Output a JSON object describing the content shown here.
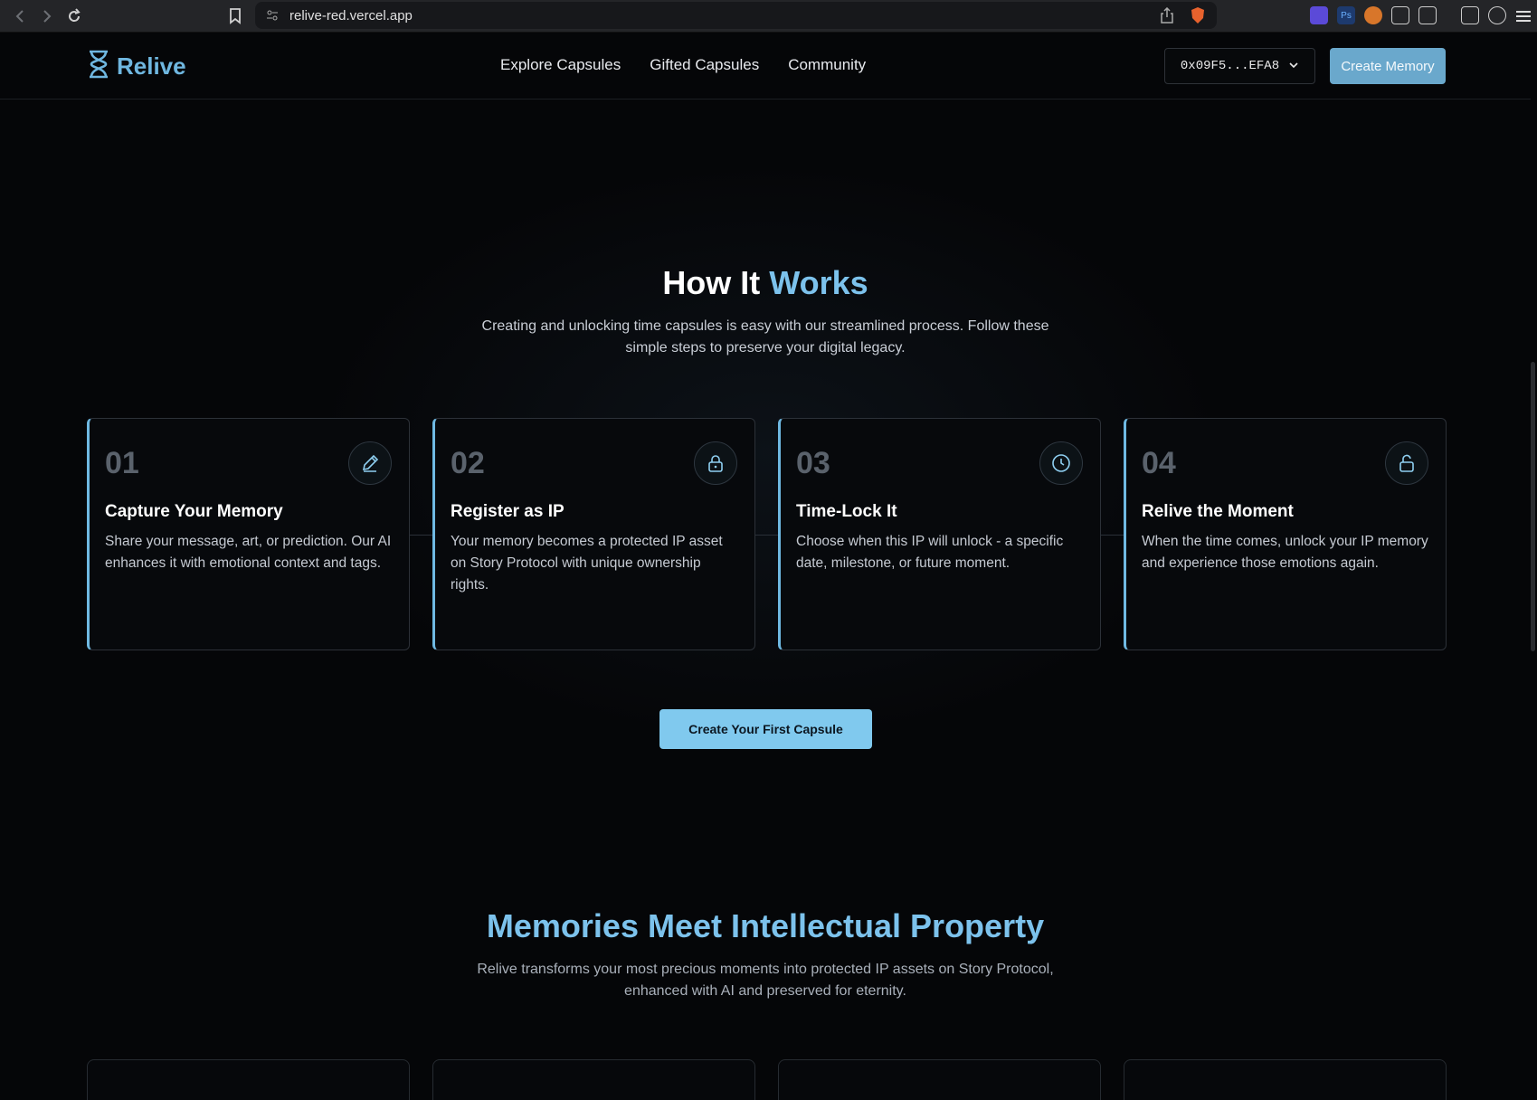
{
  "browser": {
    "url": "relive-red.vercel.app"
  },
  "header": {
    "logo_text": "Relive",
    "nav": [
      "Explore Capsules",
      "Gifted Capsules",
      "Community"
    ],
    "wallet_label": "0x09F5...EFA8",
    "create_button": "Create Memory"
  },
  "how_it_works": {
    "title_plain": "How It ",
    "title_accent": "Works",
    "subtitle_line1": "Creating and unlocking time capsules is easy with our streamlined process. Follow these",
    "subtitle_line2": "simple steps to preserve your digital legacy.",
    "steps": [
      {
        "num": "01",
        "title": "Capture Your Memory",
        "desc": "Share your message, art, or prediction. Our AI enhances it with emotional context and tags.",
        "icon": "pencil-icon"
      },
      {
        "num": "02",
        "title": "Register as IP",
        "desc": "Your memory becomes a protected IP asset on Story Protocol with unique ownership rights.",
        "icon": "lock-icon"
      },
      {
        "num": "03",
        "title": "Time-Lock It",
        "desc": "Choose when this IP will unlock - a specific date, milestone, or future moment.",
        "icon": "clock-icon"
      },
      {
        "num": "04",
        "title": "Relive the Moment",
        "desc": "When the time comes, unlock your IP memory and experience those emotions again.",
        "icon": "unlock-icon"
      }
    ],
    "cta": "Create Your First Capsule"
  },
  "memories": {
    "title": "Memories Meet Intellectual Property",
    "subtitle_line1": "Relive transforms your most precious moments into protected IP assets on Story Protocol,",
    "subtitle_line2": "enhanced with AI and preserved for eternity."
  },
  "colors": {
    "accent": "#7cc2ec",
    "button": "#80c9ee",
    "background": "#050608"
  }
}
